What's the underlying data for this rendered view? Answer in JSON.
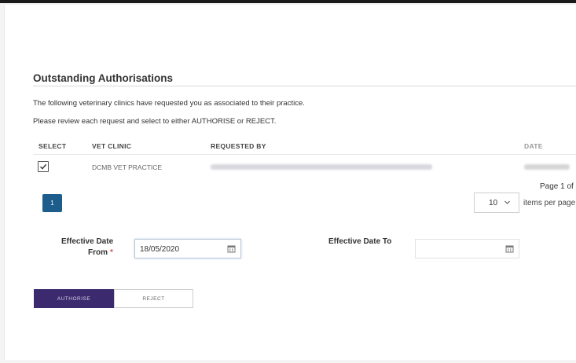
{
  "section": {
    "title": "Outstanding Authorisations",
    "intro_line_1": "The following veterinary clinics have requested you as associated to their practice.",
    "intro_line_2": "Please review each request and select to either AUTHORISE or REJECT."
  },
  "table": {
    "columns": [
      "SELECT",
      "VET CLINIC",
      "REQUESTED BY",
      "DATE"
    ],
    "rows": [
      {
        "selected": true,
        "vet_clinic": "DCMB VET PRACTICE"
      }
    ]
  },
  "pagination": {
    "current_page": "1",
    "page_info": "Page 1 of",
    "per_page_value": "10",
    "per_page_label": "items per page"
  },
  "form": {
    "from_label_line_1": "Effective Date",
    "from_label_line_2": "From",
    "required_marker": "*",
    "from_value": "18/05/2020",
    "to_label": "Effective Date To",
    "to_value": ""
  },
  "actions": {
    "authorise_label": "AUTHORISE",
    "reject_label": "REJECT"
  },
  "icons": {
    "checkbox": "checkmark-icon",
    "dropdown": "chevron-down-icon",
    "calendar": "calendar-icon"
  },
  "colors": {
    "primary": "#3b2a6e",
    "pagination_active": "#1d5d8c",
    "required": "#d9534f"
  }
}
